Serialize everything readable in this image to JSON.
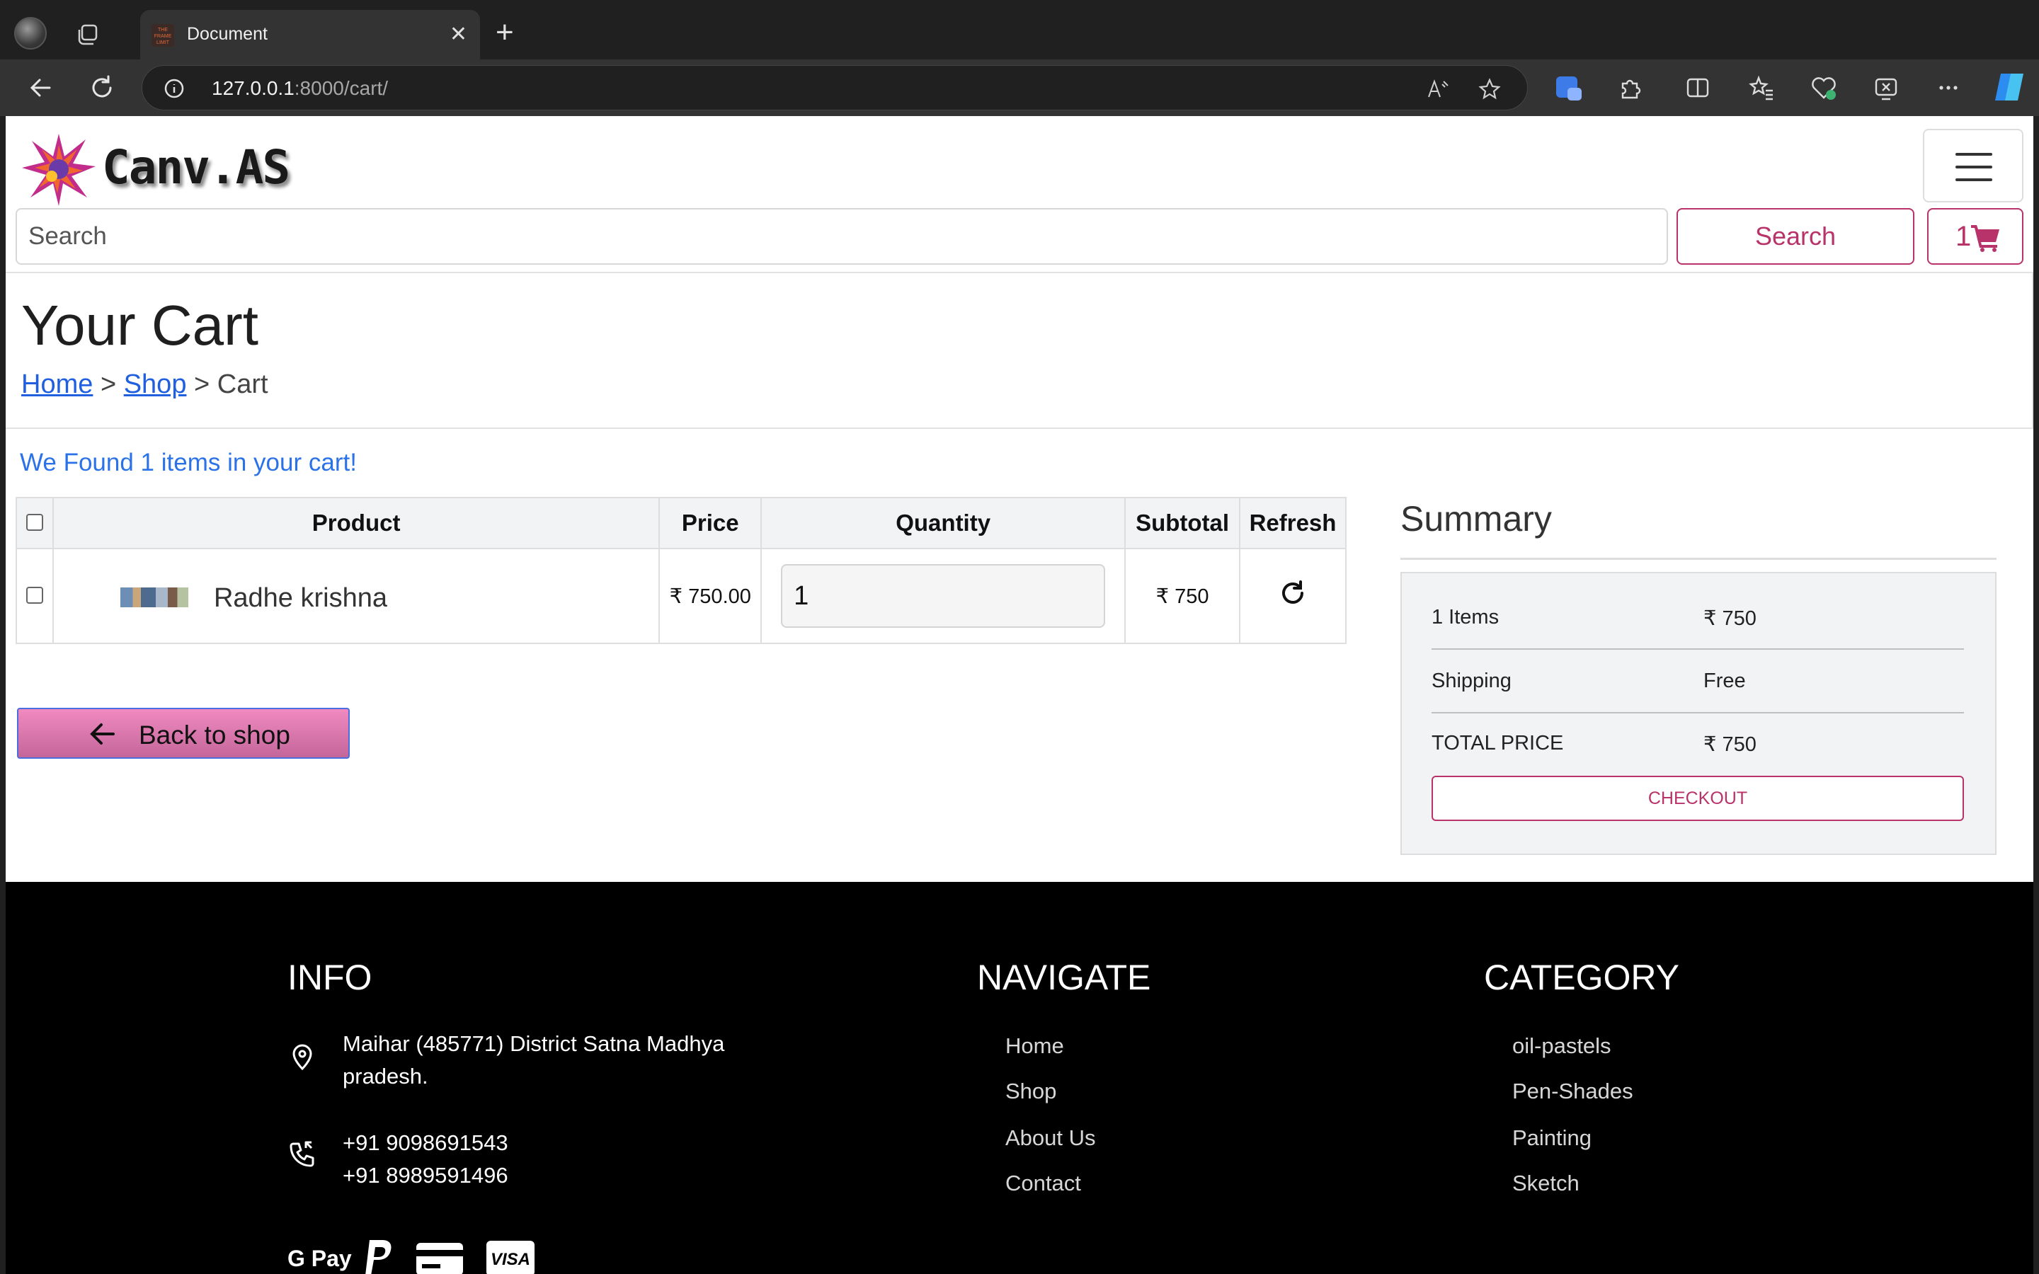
{
  "browser": {
    "tab_title": "Document",
    "tab_favicon_text": "THE FRAME LIMIT",
    "url_host": "127.0.0.1",
    "url_rest": ":8000/cart/"
  },
  "navbar": {
    "brand": "Canv.AS",
    "search_placeholder": "Search",
    "search_button": "Search",
    "cart_count": "1"
  },
  "header": {
    "title": "Your Cart",
    "breadcrumb": {
      "home": "Home",
      "sep1": ">",
      "shop": "Shop",
      "sep2": ">",
      "current": "Cart"
    }
  },
  "cart": {
    "found_text": "We Found 1 items in your cart!",
    "columns": [
      "Product",
      "Price",
      "Quantity",
      "Subtotal",
      "Refresh"
    ],
    "items": [
      {
        "name": "Radhe krishna",
        "price": "₹ 750.00",
        "quantity": "1",
        "subtotal": "₹ 750"
      }
    ],
    "back_button": "Back to shop"
  },
  "summary": {
    "title": "Summary",
    "rows": [
      {
        "label": "1 Items",
        "value": "₹ 750"
      },
      {
        "label": "Shipping",
        "value": "Free"
      },
      {
        "label": "TOTAL PRICE",
        "value": "₹ 750"
      }
    ],
    "checkout": "CHECKOUT"
  },
  "footer": {
    "info": {
      "heading": "INFO",
      "address_line1": "Maihar (485771) District Satna Madhya",
      "address_line2": "pradesh.",
      "phone1": "+91 9098691543",
      "phone2": "+91 8989591496"
    },
    "navigate": {
      "heading": "NAVIGATE",
      "links": [
        "Home",
        "Shop",
        "About Us",
        "Contact"
      ]
    },
    "category": {
      "heading": "CATEGORY",
      "links": [
        "oil-pastels",
        "Pen-Shades",
        "Painting",
        "Sketch"
      ]
    },
    "payments": [
      "G Pay",
      "PayPal",
      "Card",
      "VISA"
    ]
  },
  "colors": {
    "accent": "#b8336a",
    "link": "#1f5fe0",
    "info_text": "#2b72e8"
  }
}
